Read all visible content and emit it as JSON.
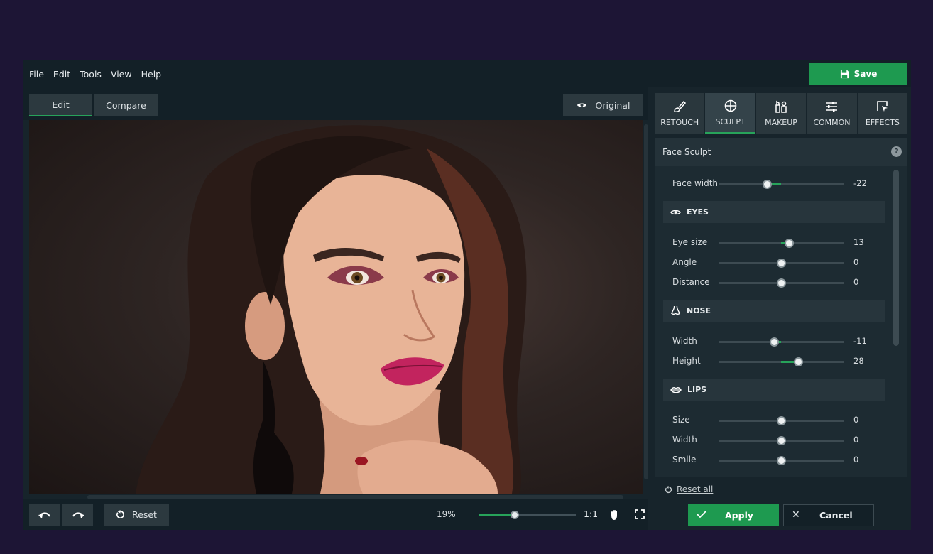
{
  "menu": [
    "File",
    "Edit",
    "Tools",
    "View",
    "Help"
  ],
  "save_label": "Save",
  "view_tabs": {
    "edit": "Edit",
    "compare": "Compare"
  },
  "original_label": "Original",
  "reset_label": "Reset",
  "zoom": {
    "label": "19%",
    "value_fraction": 0.37
  },
  "ratio_label": "1:1",
  "tabs": [
    {
      "label": "RETOUCH",
      "icon": "retouch-brush-icon"
    },
    {
      "label": "SCULPT",
      "icon": "sculpt-globe-icon"
    },
    {
      "label": "MAKEUP",
      "icon": "makeup-icon"
    },
    {
      "label": "COMMON",
      "icon": "sliders-icon"
    },
    {
      "label": "EFFECTS",
      "icon": "effects-icon"
    }
  ],
  "active_tab": "SCULPT",
  "panel_title": "Face Sculpt",
  "face": {
    "label": "Face width",
    "value": "-22",
    "num": -22
  },
  "eyes": {
    "title": "EYES",
    "rows": [
      {
        "label": "Eye size",
        "value": "13",
        "num": 13
      },
      {
        "label": "Angle",
        "value": "0",
        "num": 0
      },
      {
        "label": "Distance",
        "value": "0",
        "num": 0
      }
    ]
  },
  "nose": {
    "title": "NOSE",
    "rows": [
      {
        "label": "Width",
        "value": "-11",
        "num": -11
      },
      {
        "label": "Height",
        "value": "28",
        "num": 28
      }
    ]
  },
  "lips": {
    "title": "LIPS",
    "rows": [
      {
        "label": "Size",
        "value": "0",
        "num": 0
      },
      {
        "label": "Width",
        "value": "0",
        "num": 0
      },
      {
        "label": "Smile",
        "value": "0",
        "num": 0
      }
    ]
  },
  "reset_all_label": "Reset all",
  "apply_label": "Apply",
  "cancel_label": "Cancel",
  "colors": {
    "accent": "#27a35a",
    "background": "#1d1535",
    "panel": "#17242b"
  }
}
